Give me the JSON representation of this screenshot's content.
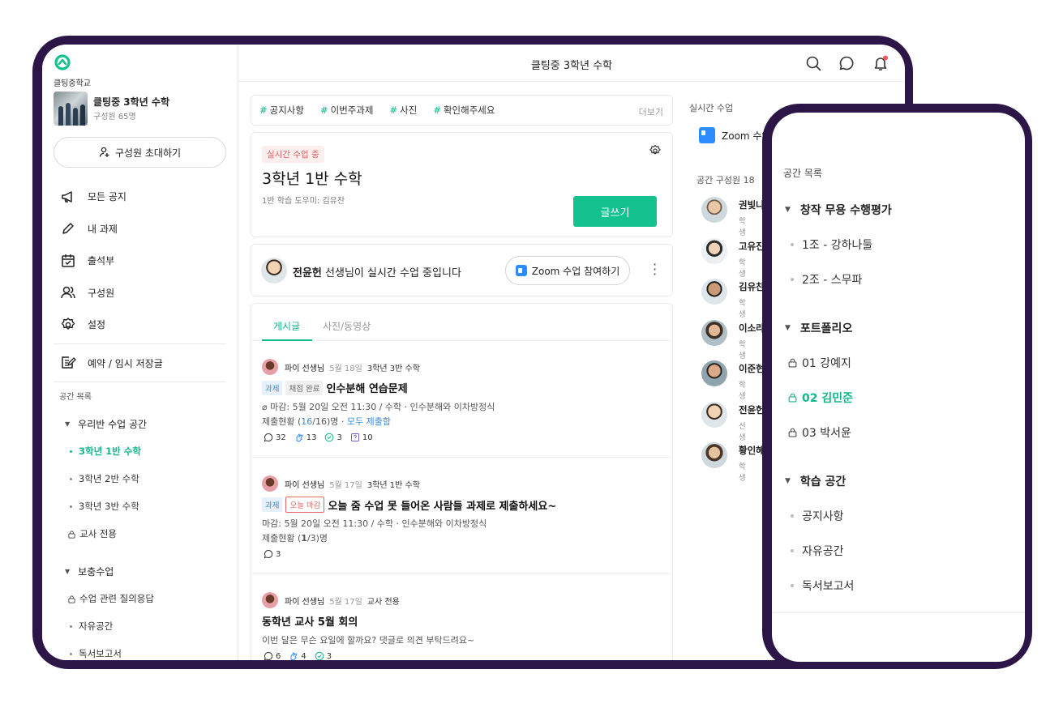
{
  "sidebar": {
    "school": "클팅중학교",
    "space_title": "클팅중 3학년 수학",
    "space_members": "구성원 65명",
    "invite": "구성원 초대하기",
    "menu": [
      "모든 공지",
      "내 과제",
      "출석부",
      "구성원",
      "설정",
      "예약 / 임시 저장글"
    ],
    "list_heading": "공간 목록",
    "groups": [
      {
        "label": "우리반 수업 공간",
        "items": [
          "3학년 1반 수학",
          "3학년 2반 수학",
          "3학년 3반 수학",
          "교사 전용"
        ]
      },
      {
        "label": "보충수업",
        "items": [
          "수업 관련 질의응답",
          "자유공간",
          "독서보고서"
        ]
      }
    ]
  },
  "topbar": {
    "title": "클팅중 3학년 수학"
  },
  "tags": {
    "items": [
      "공지사항",
      "이번주과제",
      "사진",
      "확인해주세요"
    ],
    "hash": "#",
    "more": "더보기"
  },
  "live": {
    "badge": "실시간 수업 중",
    "title": "3학년 1반 수학",
    "helper": "1반 학습 도우미: 김유찬",
    "write": "글쓰기"
  },
  "zoom": {
    "teacher": "전윤헌",
    "text": " 선생님이 실시간 수업 중입니다",
    "button": "Zoom 수업 참여하기"
  },
  "feed": {
    "tabs": [
      "게시글",
      "사진/동영상"
    ],
    "posts": [
      {
        "author": "파이 선생님",
        "date": "5월 18일",
        "space": "3학년 3반 수학",
        "chip1": "과제",
        "chip2": "채점 완료",
        "title": "인수분해 연습문제",
        "line1": "마감: 5월 20일 오전 11:30 / 수학 · 인수분해와 이차방정식",
        "line2a": "제출현황 (",
        "line2n": "16",
        "line2b": "/16)명 · ",
        "line2link": "모두 제출함",
        "stats": [
          "32",
          "13",
          "3",
          "10"
        ]
      },
      {
        "author": "파이 선생님",
        "date": "5월 17일",
        "space": "3학년 1반 수학",
        "chip1": "과제",
        "chip2": "오늘 마감",
        "title": "오늘 줌 수업 못 들어온 사람들 과제로 제출하세요~",
        "line1": "마감: 5월 20일 오전 11:30 / 수학 · 인수분해와 이차방정식",
        "line2a": "제출현황 (",
        "line2n": "1",
        "line2b": "/3)명",
        "stats": [
          "3"
        ]
      },
      {
        "author": "파이 선생님",
        "date": "5월 17일",
        "space": "교사 전용",
        "title": "동학년 교사 5월 회의",
        "line1": "이번 달은 무슨 요일에 할까요? 댓글로 의견 부탁드려요~",
        "stats": [
          "6",
          "4",
          "3"
        ]
      }
    ]
  },
  "members": {
    "live_heading": "실시간 수업",
    "live_item": "Zoom 수업",
    "heading": "공간 구성원 18",
    "list": [
      {
        "name": "권빛나",
        "role": "학생"
      },
      {
        "name": "고유진",
        "role": "학생"
      },
      {
        "name": "김유찬",
        "role": "학생"
      },
      {
        "name": "이소라",
        "role": "학생"
      },
      {
        "name": "이준현",
        "role": "학생"
      },
      {
        "name": "전윤헌",
        "role": "선생님"
      },
      {
        "name": "황인혜",
        "role": "학생"
      }
    ]
  },
  "phone": {
    "heading": "공간 목록",
    "groups": [
      {
        "label": "창작 무용 수행평가",
        "items": [
          "1조 - 강하나둘",
          "2조 - 스무파"
        ]
      },
      {
        "label": "포트폴리오",
        "items": [
          "01 강예지",
          "02 김민준",
          "03 박서윤"
        ]
      },
      {
        "label": "학습 공간",
        "items": [
          "공지사항",
          "자유공간",
          "독서보고서"
        ]
      }
    ]
  },
  "colors": {
    "accent": "#14c28f",
    "frame": "#2c1647",
    "live_red": "#e45e5e",
    "link_blue": "#3a8ad1"
  }
}
